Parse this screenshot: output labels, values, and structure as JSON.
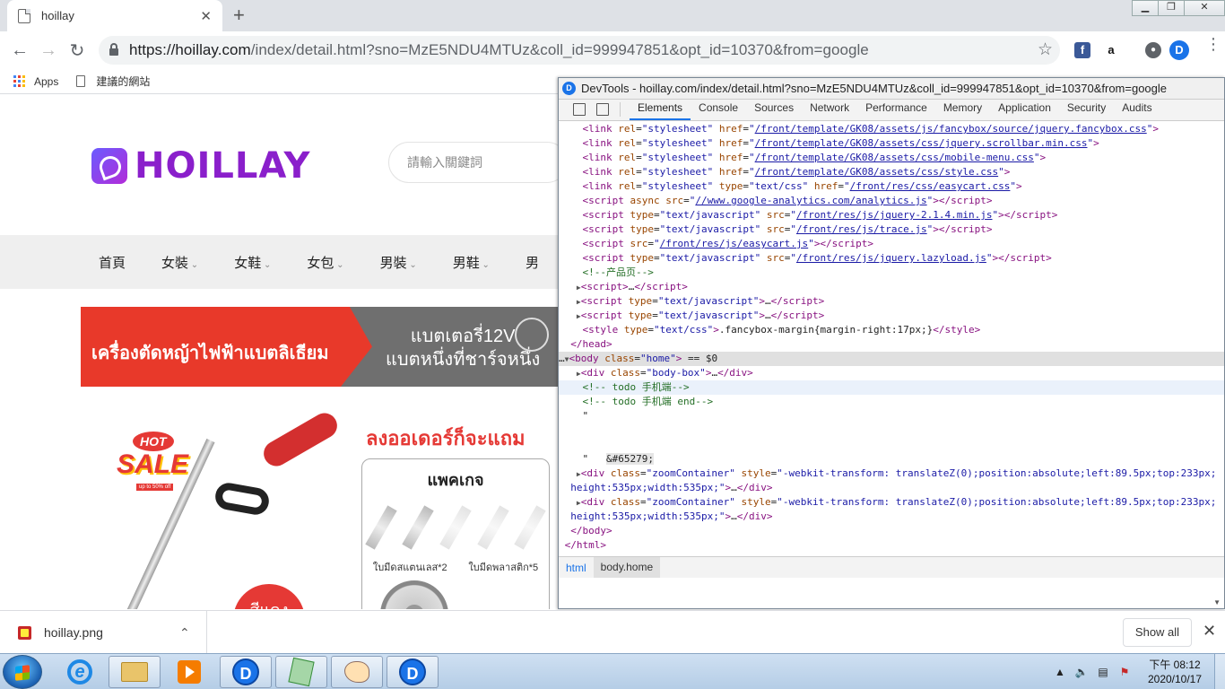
{
  "browser": {
    "tab_title": "hoillay",
    "new_tab": "+",
    "tab_close": "✕",
    "url_host": "https://hoillay.com",
    "url_path": "/index/detail.html?sno=MzE5NDU4MTUz&coll_id=999947851&opt_id=10370&from=google",
    "window_controls": [
      "▁",
      "❐",
      "✕"
    ],
    "bookmarks": [
      {
        "label": "Apps",
        "icon": "apps-grid-icon"
      },
      {
        "label": "建議的網站",
        "icon": "page-icon"
      }
    ]
  },
  "site": {
    "logo_text": "HOILLAY",
    "search_placeholder": "請輸入關鍵詞",
    "nav": [
      {
        "label": "首頁",
        "dropdown": false
      },
      {
        "label": "女裝",
        "dropdown": true
      },
      {
        "label": "女鞋",
        "dropdown": true
      },
      {
        "label": "女包",
        "dropdown": true
      },
      {
        "label": "男裝",
        "dropdown": true
      },
      {
        "label": "男鞋",
        "dropdown": true
      },
      {
        "label": "男",
        "dropdown": false
      }
    ],
    "banner_left": "เครื่องตัดหญ้าไฟฟ้าแบตลิเธียม",
    "banner_right_line1": "แบตเตอรี่12V",
    "banner_right_line2": "แบตหนึ่งที่ชาร์จหนึ่ง",
    "sale_hot": "HOT",
    "sale_text": "SALE",
    "sale_sub": "up to 50% off",
    "order_title": "ลงออเดอร์ก็จะแถม",
    "package_title": "แพคเกจ",
    "package_item1": "ใบมีดสแตนเลส*2",
    "package_item2": "ใบมีดพลาสติก*5",
    "red_circle_text": "สีแดง"
  },
  "devtools": {
    "title": "DevTools - hoillay.com/index/detail.html?sno=MzE5NDU4MTUz&coll_id=999947851&opt_id=10370&from=google",
    "tabs": [
      "Elements",
      "Console",
      "Sources",
      "Network",
      "Performance",
      "Memory",
      "Application",
      "Security",
      "Audits"
    ],
    "active_tab": "Elements",
    "breadcrumbs": [
      "html",
      "body.home"
    ],
    "link_lines": [
      {
        "href": "/front/template/GK08/assets/js/fancybox/source/jquery.fancybox.css"
      },
      {
        "href": "/front/template/GK08/assets/css/jquery.scrollbar.min.css"
      },
      {
        "href": "/front/template/GK08/assets/css/mobile-menu.css"
      },
      {
        "href": "/front/template/GK08/assets/css/style.css"
      }
    ],
    "easycart_href": "/front/res/css/easycart.css",
    "ga_src": "//www.google-analytics.com/analytics.js",
    "jquery_src": "/front/res/js/jquery-2.1.4.min.js",
    "trace_src": "/front/res/js/trace.js",
    "easycart_src": "/front/res/js/easycart.js",
    "lazyload_src": "/front/res/js/jquery.lazyload.js",
    "comment_product": "<!--产品页-->",
    "style_rule": ".fancybox-margin{margin-right:17px;}",
    "body_class": "home",
    "body_marker": "== $0",
    "comment_mobile": "<!-- todo 手机端-->",
    "comment_mobile_end": "<!-- todo 手机端 end-->",
    "entity_text": "&#65279;",
    "zoom_style_a": "-webkit-transform: translateZ(0);position:absolute;left:89.5px;top:233px;",
    "zoom_style_b": "height:535px;width:535px;"
  },
  "downloads": {
    "file_name": "hoillay.png",
    "show_all": "Show all",
    "close": "✕"
  },
  "taskbar": {
    "apps": [
      "start-button",
      "ie-icon",
      "explorer-icon",
      "media-player-icon",
      "app-d-icon",
      "notepad-icon",
      "paint-icon",
      "app-d-icon"
    ],
    "clock_time": "下午 08:12",
    "clock_date": "2020/10/17"
  }
}
